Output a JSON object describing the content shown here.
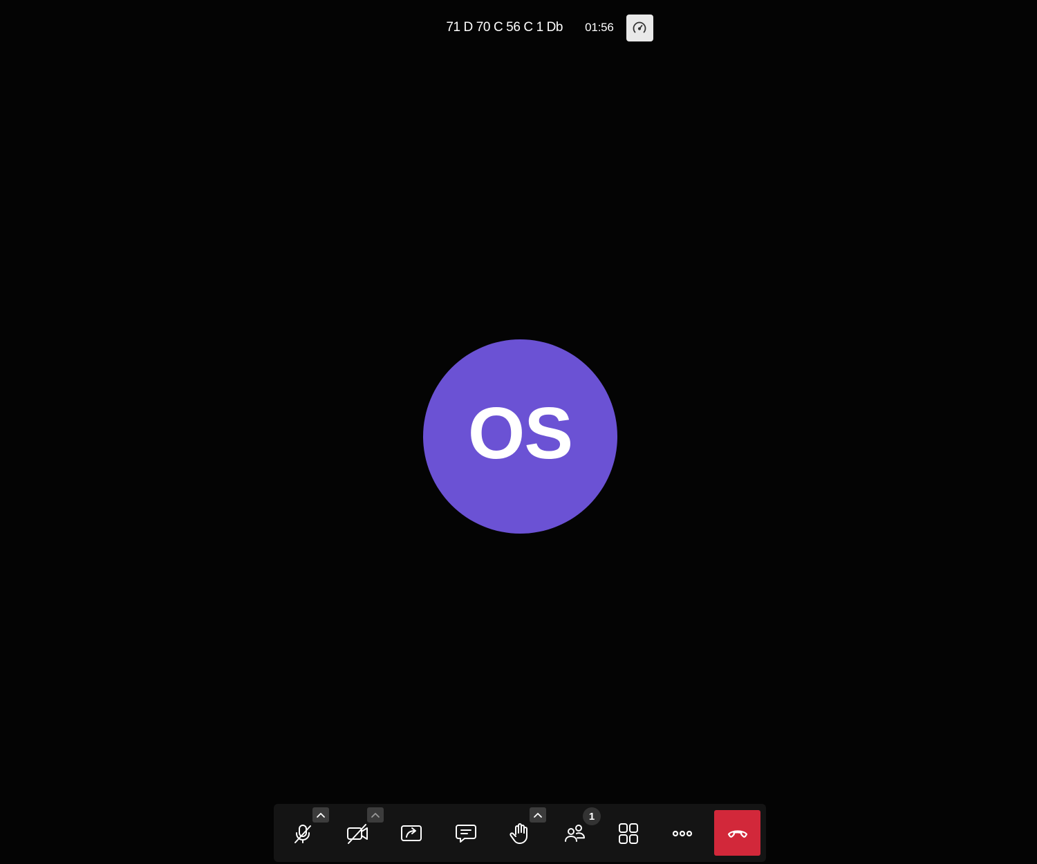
{
  "meeting": {
    "room_name": "71 D 70 C 56 C 1 Db",
    "duration": "01:56"
  },
  "participant": {
    "initials": "OS",
    "avatar_color": "#6b52d4"
  },
  "toolbar": {
    "participants_count": "1",
    "hangup_color": "#d2283a",
    "buttons": [
      {
        "name": "microphone",
        "icon": "mic-off-icon",
        "state": "muted",
        "has_options": true
      },
      {
        "name": "camera",
        "icon": "camera-off-icon",
        "state": "off",
        "has_options": true
      },
      {
        "name": "share-screen",
        "icon": "share-screen-icon"
      },
      {
        "name": "chat",
        "icon": "chat-icon"
      },
      {
        "name": "raise-hand",
        "icon": "hand-icon",
        "has_options": true
      },
      {
        "name": "participants",
        "icon": "participants-icon"
      },
      {
        "name": "tile-view",
        "icon": "grid-icon"
      },
      {
        "name": "more-actions",
        "icon": "more-icon"
      },
      {
        "name": "leave",
        "icon": "hangup-icon"
      }
    ]
  }
}
